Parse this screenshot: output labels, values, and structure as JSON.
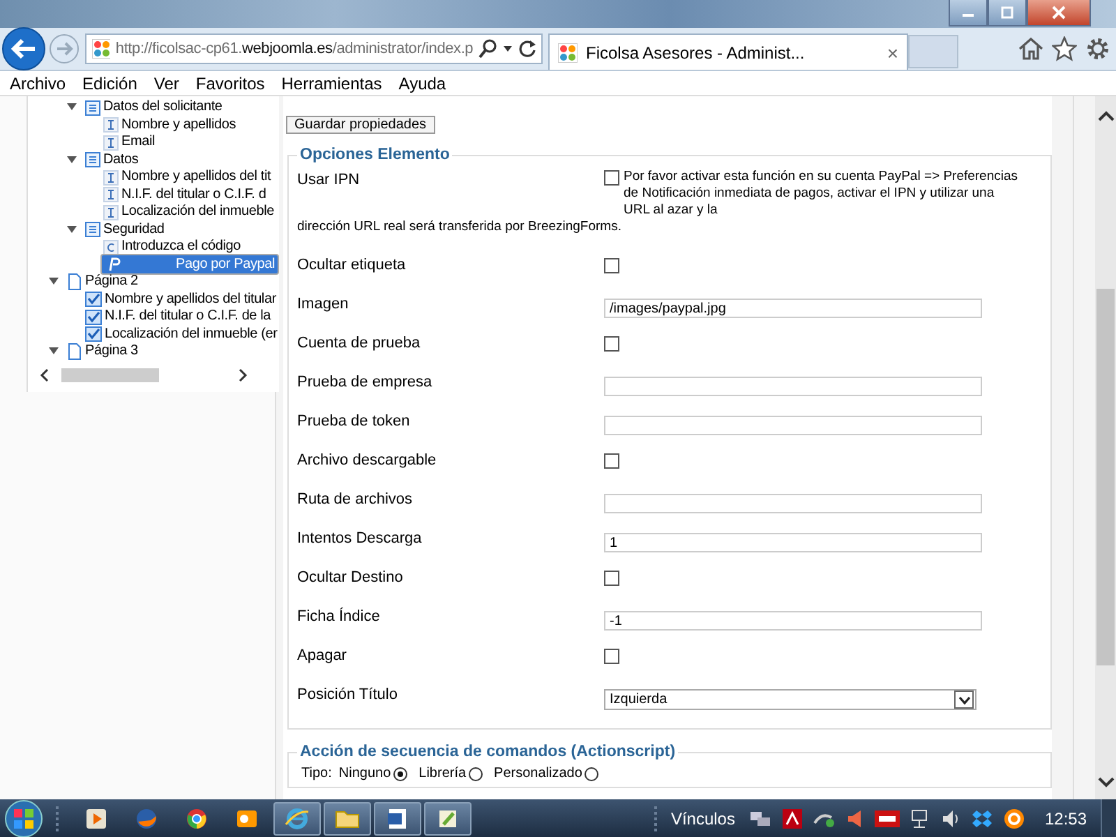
{
  "browser": {
    "url": "http://ficolsac-cp61.**webjoomla.es**/administrator/index.p",
    "tab_title": "Ficolsa Asesores - Administ...",
    "tab_close": "×"
  },
  "menu": [
    "Archivo",
    "Edición",
    "Ver",
    "Favoritos",
    "Herramientas",
    "Ayuda"
  ],
  "tree": {
    "open_page_items": [
      {
        "label": "Datos del solicitante",
        "kind": "section",
        "expanded": true,
        "selected": false,
        "children": [
          {
            "label": "Nombre y apellidos",
            "kind": "text",
            "selected": false
          },
          {
            "label": "Email",
            "kind": "text",
            "selected": false
          }
        ]
      },
      {
        "label": "Datos",
        "kind": "section",
        "expanded": true,
        "selected": false,
        "children": [
          {
            "label": "Nombre y apellidos del tit",
            "kind": "text",
            "selected": false
          },
          {
            "label": "N.I.F. del titular o C.I.F. d",
            "kind": "text",
            "selected": false
          },
          {
            "label": "Localización del inmueble",
            "kind": "text",
            "selected": false
          }
        ]
      },
      {
        "label": "Seguridad",
        "kind": "section",
        "expanded": true,
        "selected": false,
        "children": [
          {
            "label": "Introduzca el código",
            "kind": "captcha",
            "selected": false
          },
          {
            "label": "Pago por Paypal",
            "kind": "paypal",
            "selected": true
          }
        ]
      }
    ],
    "pages": [
      {
        "label": "Página 2",
        "kind": "page",
        "expanded": true,
        "selected": false,
        "children": [
          {
            "label": "Nombre y apellidos del titular",
            "kind": "checkbox",
            "selected": false
          },
          {
            "label": "N.I.F. del titular o C.I.F. de la",
            "kind": "checkbox",
            "selected": false
          },
          {
            "label": "Localización del inmueble (er",
            "kind": "checkbox",
            "selected": false
          }
        ]
      },
      {
        "label": "Página 3",
        "kind": "page",
        "expanded": true,
        "selected": false
      }
    ]
  },
  "save_button": "Guardar propiedades",
  "element_options": {
    "title": "Opciones Elemento",
    "rows": [
      {
        "label": "Usar IPN",
        "kind": "checkbox_note",
        "checked": false,
        "note": "Por favor activar esta función en su cuenta PayPal => Preferencias de Notificación inmediata de pagos, activar el IPN y utilizar una URL al azar y la",
        "continuation": "dirección URL real será transferida por BreezingForms."
      },
      {
        "label": "Ocultar etiqueta",
        "kind": "checkbox",
        "checked": false
      },
      {
        "label": "Imagen",
        "kind": "text",
        "value": "/images/paypal.jpg"
      },
      {
        "label": "Cuenta de prueba",
        "kind": "checkbox",
        "checked": false
      },
      {
        "label": "Prueba de empresa",
        "kind": "text"
      },
      {
        "label": "Prueba de token",
        "kind": "text"
      },
      {
        "label": "Archivo descargable",
        "kind": "checkbox",
        "checked": false
      },
      {
        "label": "Ruta de archivos",
        "kind": "text"
      },
      {
        "label": "Intentos Descarga",
        "kind": "text",
        "value": "1"
      },
      {
        "label": "Ocultar Destino",
        "kind": "checkbox",
        "checked": false
      },
      {
        "label": "Ficha Índice",
        "kind": "text",
        "value": "-1"
      },
      {
        "label": "Apagar",
        "kind": "checkbox",
        "checked": false
      },
      {
        "label": "Posición Título",
        "kind": "select",
        "value": "Izquierda"
      }
    ]
  },
  "actionscript": {
    "title": "Acción de secuencia de comandos (Actionscript)",
    "prefix": "Tipo:",
    "options": [
      {
        "label": "Ninguno",
        "selected": true
      },
      {
        "label": "Librería",
        "selected": false
      },
      {
        "label": "Personalizado",
        "selected": false
      }
    ]
  },
  "taskbar": {
    "links_label": "Vínculos",
    "clock": "12:53"
  }
}
